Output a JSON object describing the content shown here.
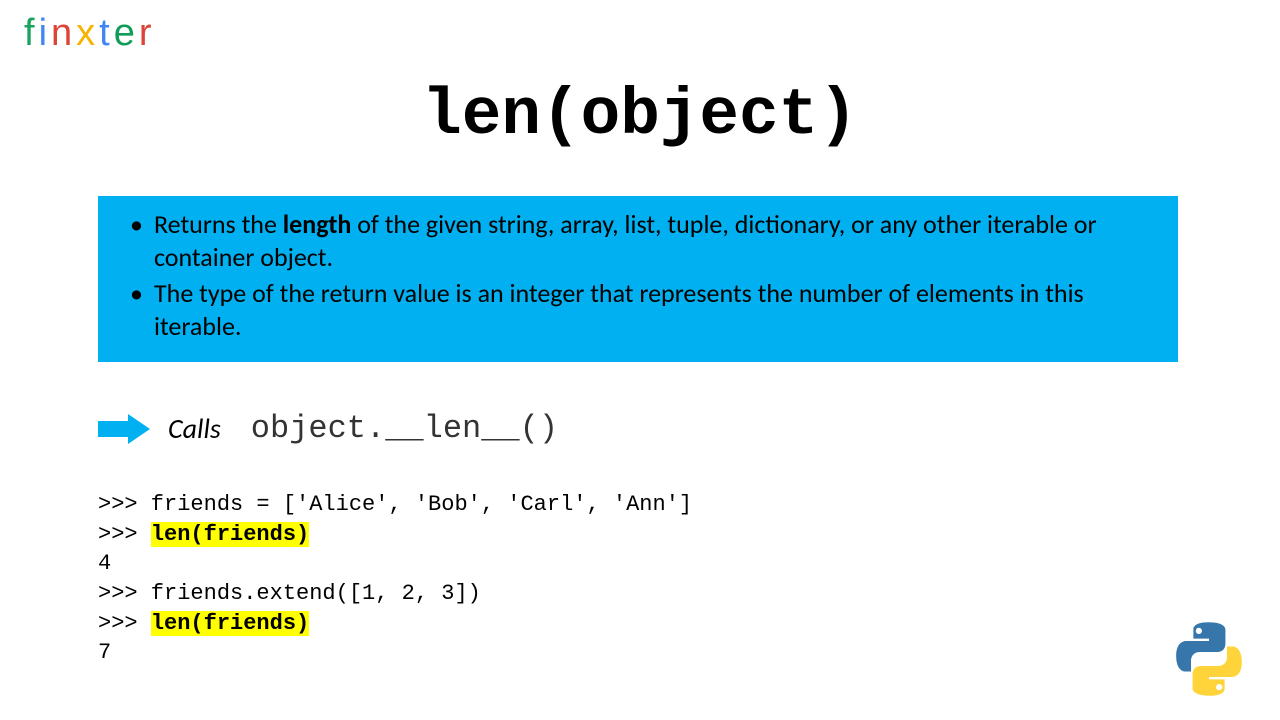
{
  "logo": {
    "f": "f",
    "i": "i",
    "n": "n",
    "x": "x",
    "t": "t",
    "e": "e",
    "r": "r"
  },
  "title": "len(object)",
  "bullets": {
    "b1_pre": "Returns the ",
    "b1_strong": "length",
    "b1_post": " of the given string, array, list, tuple, dictionary, or any other iterable or container object.",
    "b2": "The type of the return value is an integer that represents the number of elements in this iterable."
  },
  "calls": {
    "label": "Calls",
    "code": "object.__len__()"
  },
  "code": {
    "l1": ">>> friends = ['Alice', 'Bob', 'Carl', 'Ann']",
    "l2_prompt": ">>> ",
    "l2_hl": "len(friends)",
    "l3": "4",
    "l4": ">>> friends.extend([1, 2, 3])",
    "l5_prompt": ">>> ",
    "l5_hl": "len(friends)",
    "l6": "7"
  }
}
